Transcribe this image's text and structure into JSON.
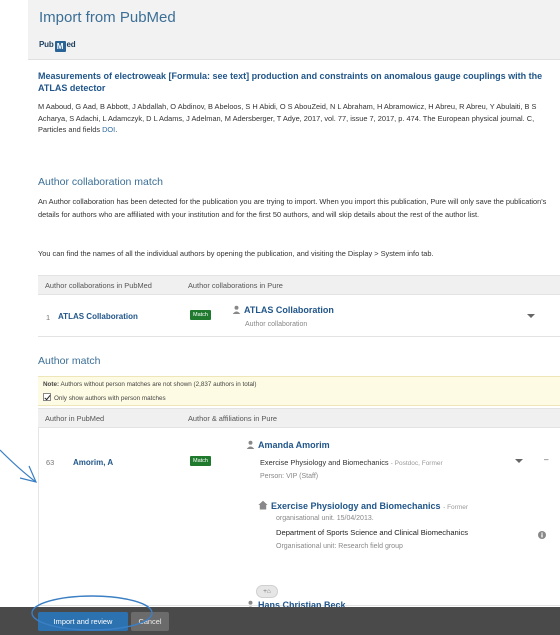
{
  "header": {
    "title": "Import from PubMed",
    "logo_pre": "Pub",
    "logo_mid": "M",
    "logo_post": "ed"
  },
  "publication": {
    "title": "Measurements of electroweak [Formula: see text] production and constraints on anomalous gauge couplings with the ATLAS detector",
    "meta": "M Aaboud, G Aad, B Abbott, J Abdallah, O Abdinov, B Abeloos, S H Abidi, O S AbouZeid, N L Abraham, H Abramowicz, H Abreu, R Abreu, Y Abulaiti, B S Acharya, S Adachi, L Adamczyk, D L Adams, J Adelman, M Adersberger, T Adye, 2017, vol. 77, issue 7, 2017, p. 474. The European physical journal. C, Particles and fields",
    "doi_link": "DOI",
    "doi_suffix": "."
  },
  "collab": {
    "heading": "Author collaboration match",
    "para1": "An Author collaboration has been detected for the publication you are trying to import. When you import this publication, Pure will only save the publication's details for authors who are affiliated with your institution and for the first 50 authors, and will skip details about the rest of the author list.",
    "para2": "You can find the names of all the individual authors by opening the publication, and visiting the Display > System info tab.",
    "col1": "Author collaborations in PubMed",
    "col2": "Author collaborations in Pure",
    "row": {
      "num": "1",
      "name": "ATLAS Collaboration",
      "badge": "Match",
      "pure_name": "ATLAS Collaboration",
      "pure_sub": "Author collaboration"
    }
  },
  "author_match": {
    "heading": "Author match",
    "note_label": "Note:",
    "note_text": "Authors without person matches are not shown (2,837 authors in total)",
    "checkbox_label": "Only show authors with person matches",
    "col1": "Author in PubMed",
    "col2": "Author & affiliations in Pure",
    "row1": {
      "num": "63",
      "name": "Amorim, A",
      "badge": "Match",
      "person": "Amanda Amorim",
      "affil_line": "Exercise Physiology and Biomechanics",
      "affil_suffix": "- Postdoc, Former",
      "person_type": "Person: VIP (Staff)",
      "org_name": "Exercise Physiology and Biomechanics",
      "org_suffix": "- Former",
      "org_type": "organisational unit. 15/04/2013.",
      "dept": "Department of Sports Science and Clinical Biomechanics",
      "dept_type": "Organisational unit: Research field group",
      "add_label": "+⌂",
      "dash": "–"
    },
    "row2": {
      "person": "Hans Christian Beck"
    }
  },
  "footer": {
    "import_label": "Import and review",
    "cancel_label": "Cancel"
  },
  "colors": {
    "accent": "#2d72b0",
    "match_badge": "#1f7a2e",
    "link": "#21568a",
    "annotation": "#3b7fc4"
  }
}
